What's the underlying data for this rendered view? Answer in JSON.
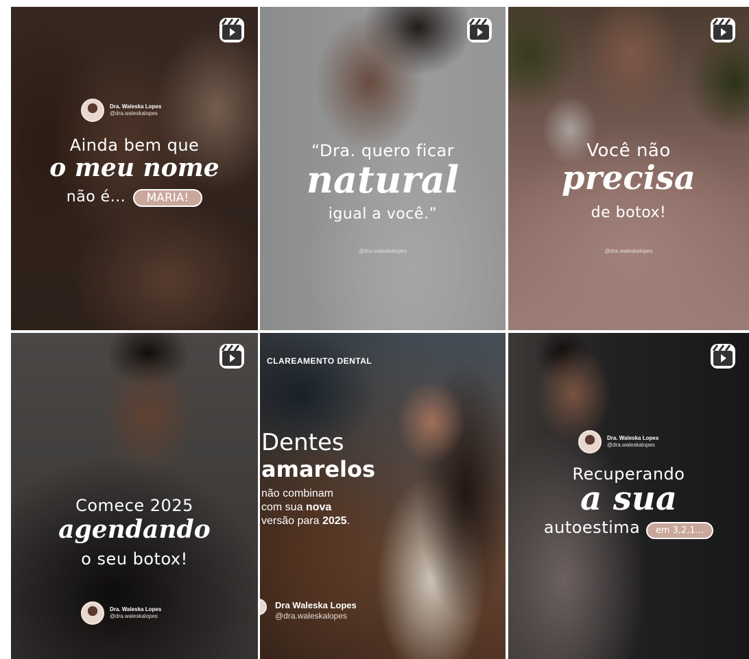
{
  "tiles": [
    {
      "profile": {
        "name": "Dra. Waleska Lopes",
        "handle": "@dra.waleskalopes"
      },
      "line1": "Ainda bem que",
      "line2": "o meu nome",
      "line3": "não é...",
      "pill": "MARIA!"
    },
    {
      "line1": "“Dra. quero ficar",
      "line2": "natural",
      "line3": "igual a você.”",
      "handle": "@dra.waleskalopes"
    },
    {
      "line1": "Você não",
      "line2": "precisa",
      "line3": "de botox!",
      "handle": "@dra.waleskalopes"
    },
    {
      "line1": "Comece 2025",
      "line2": "agendando",
      "line3": "o seu botox!",
      "profile": {
        "name": "Dra. Waleska Lopes",
        "handle": "@dra.waleskalopes"
      }
    },
    {
      "tag": "CLAREAMENTO DENTAL",
      "line1": "Dentes",
      "line2": "amarelos",
      "body1": "não combinam",
      "body2a": "com sua ",
      "body2b": "nova",
      "body3a": "versão para ",
      "body3b": "2025",
      "body3c": ".",
      "name": "Dra Waleska Lopes",
      "handle": "@dra.waleskalopes"
    },
    {
      "profile": {
        "name": "Dra. Waleska Lopes",
        "handle": "@dra.waleskalopes"
      },
      "line1": "Recuperando",
      "line2": "a sua",
      "line3": "autoestima",
      "pill": "em 3,2,1..."
    }
  ],
  "icons": {
    "reels": "reels-icon"
  },
  "colors": {
    "pill": "#c9a79b",
    "text": "#ffffff"
  }
}
